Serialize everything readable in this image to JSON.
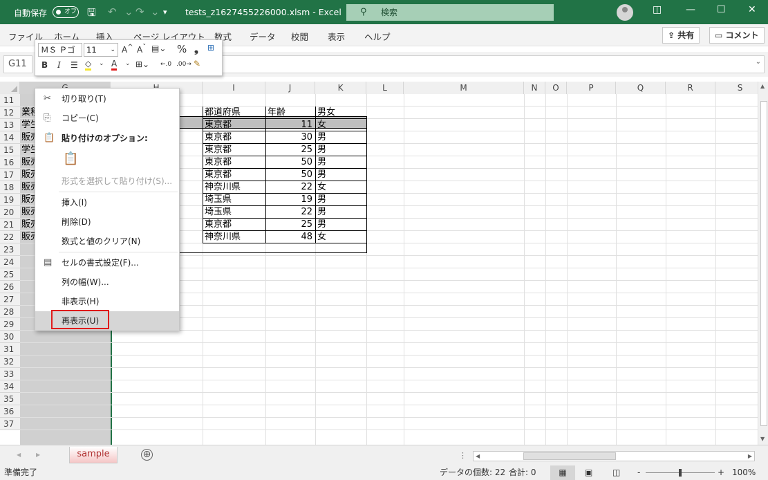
{
  "titlebar": {
    "autosave_label": "自動保存",
    "autosave_state": "オフ",
    "filename": "tests_z1627455226000.xlsm",
    "separator": "-",
    "app": "Excel",
    "search_placeholder": "検索"
  },
  "ribbon": {
    "tabs": [
      "ファイル",
      "ホーム",
      "挿入",
      "ページ レイアウト",
      "数式",
      "データ",
      "校閲",
      "表示",
      "ヘルプ"
    ],
    "share": "共有",
    "comment": "コメント"
  },
  "formula_bar": {
    "name_box": "G11",
    "formula": ""
  },
  "mini_toolbar": {
    "font": "ＭＳ Ｐゴ",
    "size": "11",
    "bold": "B",
    "italic": "I",
    "percent": "%",
    "comma": "❟"
  },
  "columns": [
    "G",
    "H",
    "I",
    "J",
    "K",
    "L",
    "M",
    "N",
    "O",
    "P",
    "Q",
    "R",
    "S"
  ],
  "rows": [
    "11",
    "12",
    "13",
    "14",
    "15",
    "16",
    "17",
    "18",
    "19",
    "20",
    "21",
    "22",
    "23",
    "24",
    "25",
    "26",
    "27",
    "28",
    "29",
    "30",
    "31",
    "32",
    "33",
    "34",
    "35",
    "36",
    "37"
  ],
  "col_g_values": [
    "業種",
    "学生",
    "販売",
    "学生",
    "販売",
    "販売",
    "販売",
    "販売",
    "販売",
    "販売",
    "販売"
  ],
  "table": {
    "headers": [
      "都道府県",
      "年齢",
      "男女"
    ],
    "rows": [
      [
        "東京都",
        "11",
        "女"
      ],
      [
        "東京都",
        "30",
        "男"
      ],
      [
        "東京都",
        "25",
        "男"
      ],
      [
        "東京都",
        "50",
        "男"
      ],
      [
        "東京都",
        "50",
        "男"
      ],
      [
        "神奈川県",
        "22",
        "女"
      ],
      [
        "埼玉県",
        "19",
        "男"
      ],
      [
        "埼玉県",
        "22",
        "男"
      ],
      [
        "東京都",
        "25",
        "男"
      ],
      [
        "神奈川県",
        "48",
        "女"
      ]
    ]
  },
  "context_menu": {
    "cut": "切り取り(T)",
    "copy": "コピー(C)",
    "paste_options": "貼り付けのオプション:",
    "paste_special": "形式を選択して貼り付け(S)...",
    "insert": "挿入(I)",
    "delete": "削除(D)",
    "clear": "数式と値のクリア(N)",
    "format_cells": "セルの書式設定(F)...",
    "column_width": "列の幅(W)...",
    "hide": "非表示(H)",
    "unhide": "再表示(U)"
  },
  "sheet_tabs": {
    "active": "sample",
    "add": "⊕"
  },
  "statusbar": {
    "ready": "準備完了",
    "count_label": "データの個数: 22",
    "sum_label": "合計: 0",
    "zoom": "100%",
    "minus": "-",
    "plus": "+"
  },
  "colors": {
    "excel_green": "#217346",
    "highlight_red": "#e01b1b",
    "hidden_col": "#d0d0d0",
    "table_header": "#bfbfbf"
  }
}
